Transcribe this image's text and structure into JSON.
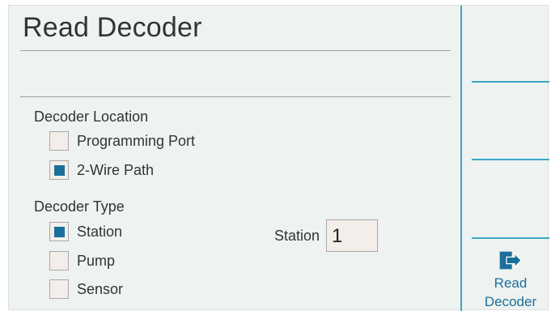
{
  "title": "Read Decoder",
  "location": {
    "label": "Decoder Location",
    "options": [
      {
        "label": "Programming Port",
        "checked": false
      },
      {
        "label": "2-Wire Path",
        "checked": true
      }
    ]
  },
  "type": {
    "label": "Decoder Type",
    "options": [
      {
        "label": "Station",
        "checked": true
      },
      {
        "label": "Pump",
        "checked": false
      },
      {
        "label": "Sensor",
        "checked": false
      }
    ]
  },
  "station": {
    "label": "Station",
    "value": "1"
  },
  "softkey": {
    "line1": "Read",
    "line2": "Decoder",
    "icon": "read-decoder-icon"
  },
  "colors": {
    "accent": "#3aa6c9",
    "checked": "#1b6f9a",
    "background": "#eef3f1"
  }
}
